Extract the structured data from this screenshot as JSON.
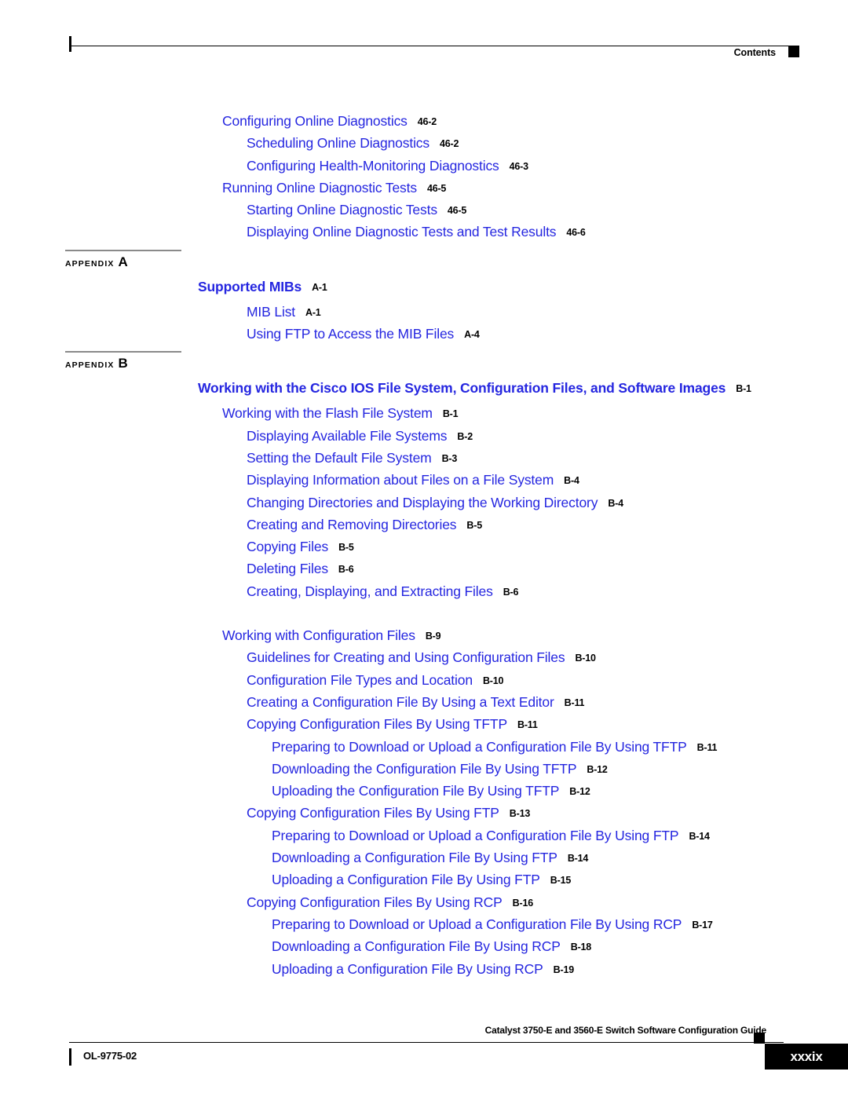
{
  "header": {
    "label": "Contents",
    "square_icon": "black-square-marker"
  },
  "colors": {
    "link_blue": "#2526E0",
    "page_number_black": "#000000",
    "appendix_rule_gray": "#8a8a8a"
  },
  "toc": {
    "groups": [
      {
        "id": "chapter-46-continued",
        "entries": [
          {
            "level": 1,
            "title": "Configuring Online Diagnostics",
            "page": "46-2"
          },
          {
            "level": 2,
            "title": "Scheduling Online Diagnostics",
            "page": "46-2"
          },
          {
            "level": 2,
            "title": "Configuring Health-Monitoring Diagnostics",
            "page": "46-3"
          },
          {
            "level": 1,
            "title": "Running Online Diagnostic Tests",
            "page": "46-5"
          },
          {
            "level": 2,
            "title": "Starting Online Diagnostic Tests",
            "page": "46-5"
          },
          {
            "level": 2,
            "title": "Displaying Online Diagnostic Tests and Test Results",
            "page": "46-6"
          }
        ]
      },
      {
        "id": "appendix-a",
        "marker": {
          "word": "APPENDIX",
          "letter": "A"
        },
        "title": {
          "text": "Supported MIBs",
          "page": "A-1"
        },
        "entries": [
          {
            "level": 2,
            "title": "MIB List",
            "page": "A-1"
          },
          {
            "level": 2,
            "title": "Using FTP to Access the MIB Files",
            "page": "A-4"
          }
        ]
      },
      {
        "id": "appendix-b",
        "marker": {
          "word": "APPENDIX",
          "letter": "B"
        },
        "title": {
          "text": "Working with the Cisco IOS File System, Configuration Files, and Software Images",
          "page": "B-1"
        },
        "entries": [
          {
            "level": 1,
            "title": "Working with the Flash File System",
            "page": "B-1"
          },
          {
            "level": 2,
            "title": "Displaying Available File Systems",
            "page": "B-2"
          },
          {
            "level": 2,
            "title": "Setting the Default File System",
            "page": "B-3"
          },
          {
            "level": 2,
            "title": "Displaying Information about Files on a File System",
            "page": "B-4"
          },
          {
            "level": 2,
            "title": "Changing Directories and Displaying the Working Directory",
            "page": "B-4"
          },
          {
            "level": 2,
            "title": "Creating and Removing Directories",
            "page": "B-5"
          },
          {
            "level": 2,
            "title": "Copying Files",
            "page": "B-5"
          },
          {
            "level": 2,
            "title": "Deleting Files",
            "page": "B-6"
          },
          {
            "level": 2,
            "title": "Creating, Displaying, and Extracting Files",
            "page": "B-6"
          },
          {
            "level": 1,
            "title": "Working with Configuration Files",
            "page": "B-9",
            "gap_before": true
          },
          {
            "level": 2,
            "title": "Guidelines for Creating and Using Configuration Files",
            "page": "B-10"
          },
          {
            "level": 2,
            "title": "Configuration File Types and Location",
            "page": "B-10"
          },
          {
            "level": 2,
            "title": "Creating a Configuration File By Using a Text Editor",
            "page": "B-11"
          },
          {
            "level": 2,
            "title": "Copying Configuration Files By Using TFTP",
            "page": "B-11"
          },
          {
            "level": 3,
            "title": "Preparing to Download or Upload a Configuration File By Using TFTP",
            "page": "B-11"
          },
          {
            "level": 3,
            "title": "Downloading the Configuration File By Using TFTP",
            "page": "B-12"
          },
          {
            "level": 3,
            "title": "Uploading the Configuration File By Using TFTP",
            "page": "B-12"
          },
          {
            "level": 2,
            "title": "Copying Configuration Files By Using FTP",
            "page": "B-13"
          },
          {
            "level": 3,
            "title": "Preparing to Download or Upload a Configuration File By Using FTP",
            "page": "B-14"
          },
          {
            "level": 3,
            "title": "Downloading a Configuration File By Using FTP",
            "page": "B-14"
          },
          {
            "level": 3,
            "title": "Uploading a Configuration File By Using FTP",
            "page": "B-15"
          },
          {
            "level": 2,
            "title": "Copying Configuration Files By Using RCP",
            "page": "B-16"
          },
          {
            "level": 3,
            "title": "Preparing to Download or Upload a Configuration File By Using RCP",
            "page": "B-17"
          },
          {
            "level": 3,
            "title": "Downloading a Configuration File By Using RCP",
            "page": "B-18"
          },
          {
            "level": 3,
            "title": "Uploading a Configuration File By Using RCP",
            "page": "B-19"
          }
        ]
      }
    ]
  },
  "footer": {
    "guide_title": "Catalyst 3750-E and 3560-E Switch Software Configuration Guide",
    "doc_id": "OL-9775-02",
    "page_number": "xxxix",
    "square_icon": "black-square-marker"
  }
}
